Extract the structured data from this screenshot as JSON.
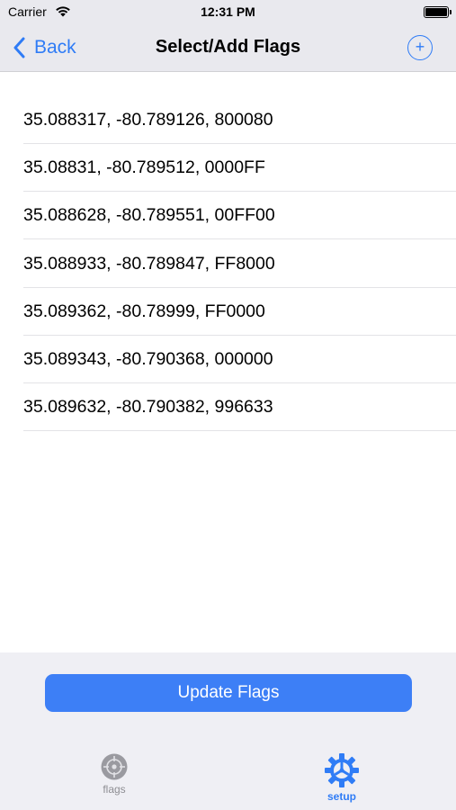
{
  "status_bar": {
    "carrier": "Carrier",
    "time": "12:31 PM"
  },
  "nav": {
    "back_label": "Back",
    "title": "Select/Add Flags",
    "add_symbol": "+"
  },
  "flags": [
    "35.088317, -80.789126, 800080",
    "35.08831, -80.789512, 0000FF",
    "35.088628, -80.789551, 00FF00",
    "35.088933, -80.789847, FF8000",
    "35.089362, -80.78999, FF0000",
    "35.089343, -80.790368, 000000",
    "35.089632, -80.790382, 996633"
  ],
  "update_button_label": "Update Flags",
  "tabs": [
    {
      "label": "flags",
      "icon": "target-icon",
      "selected": false
    },
    {
      "label": "setup",
      "icon": "gear-icon",
      "selected": true
    }
  ],
  "colors": {
    "accent": "#2f7cf6",
    "button": "#3d7ff6",
    "inactive_tab": "#8e8e93"
  }
}
